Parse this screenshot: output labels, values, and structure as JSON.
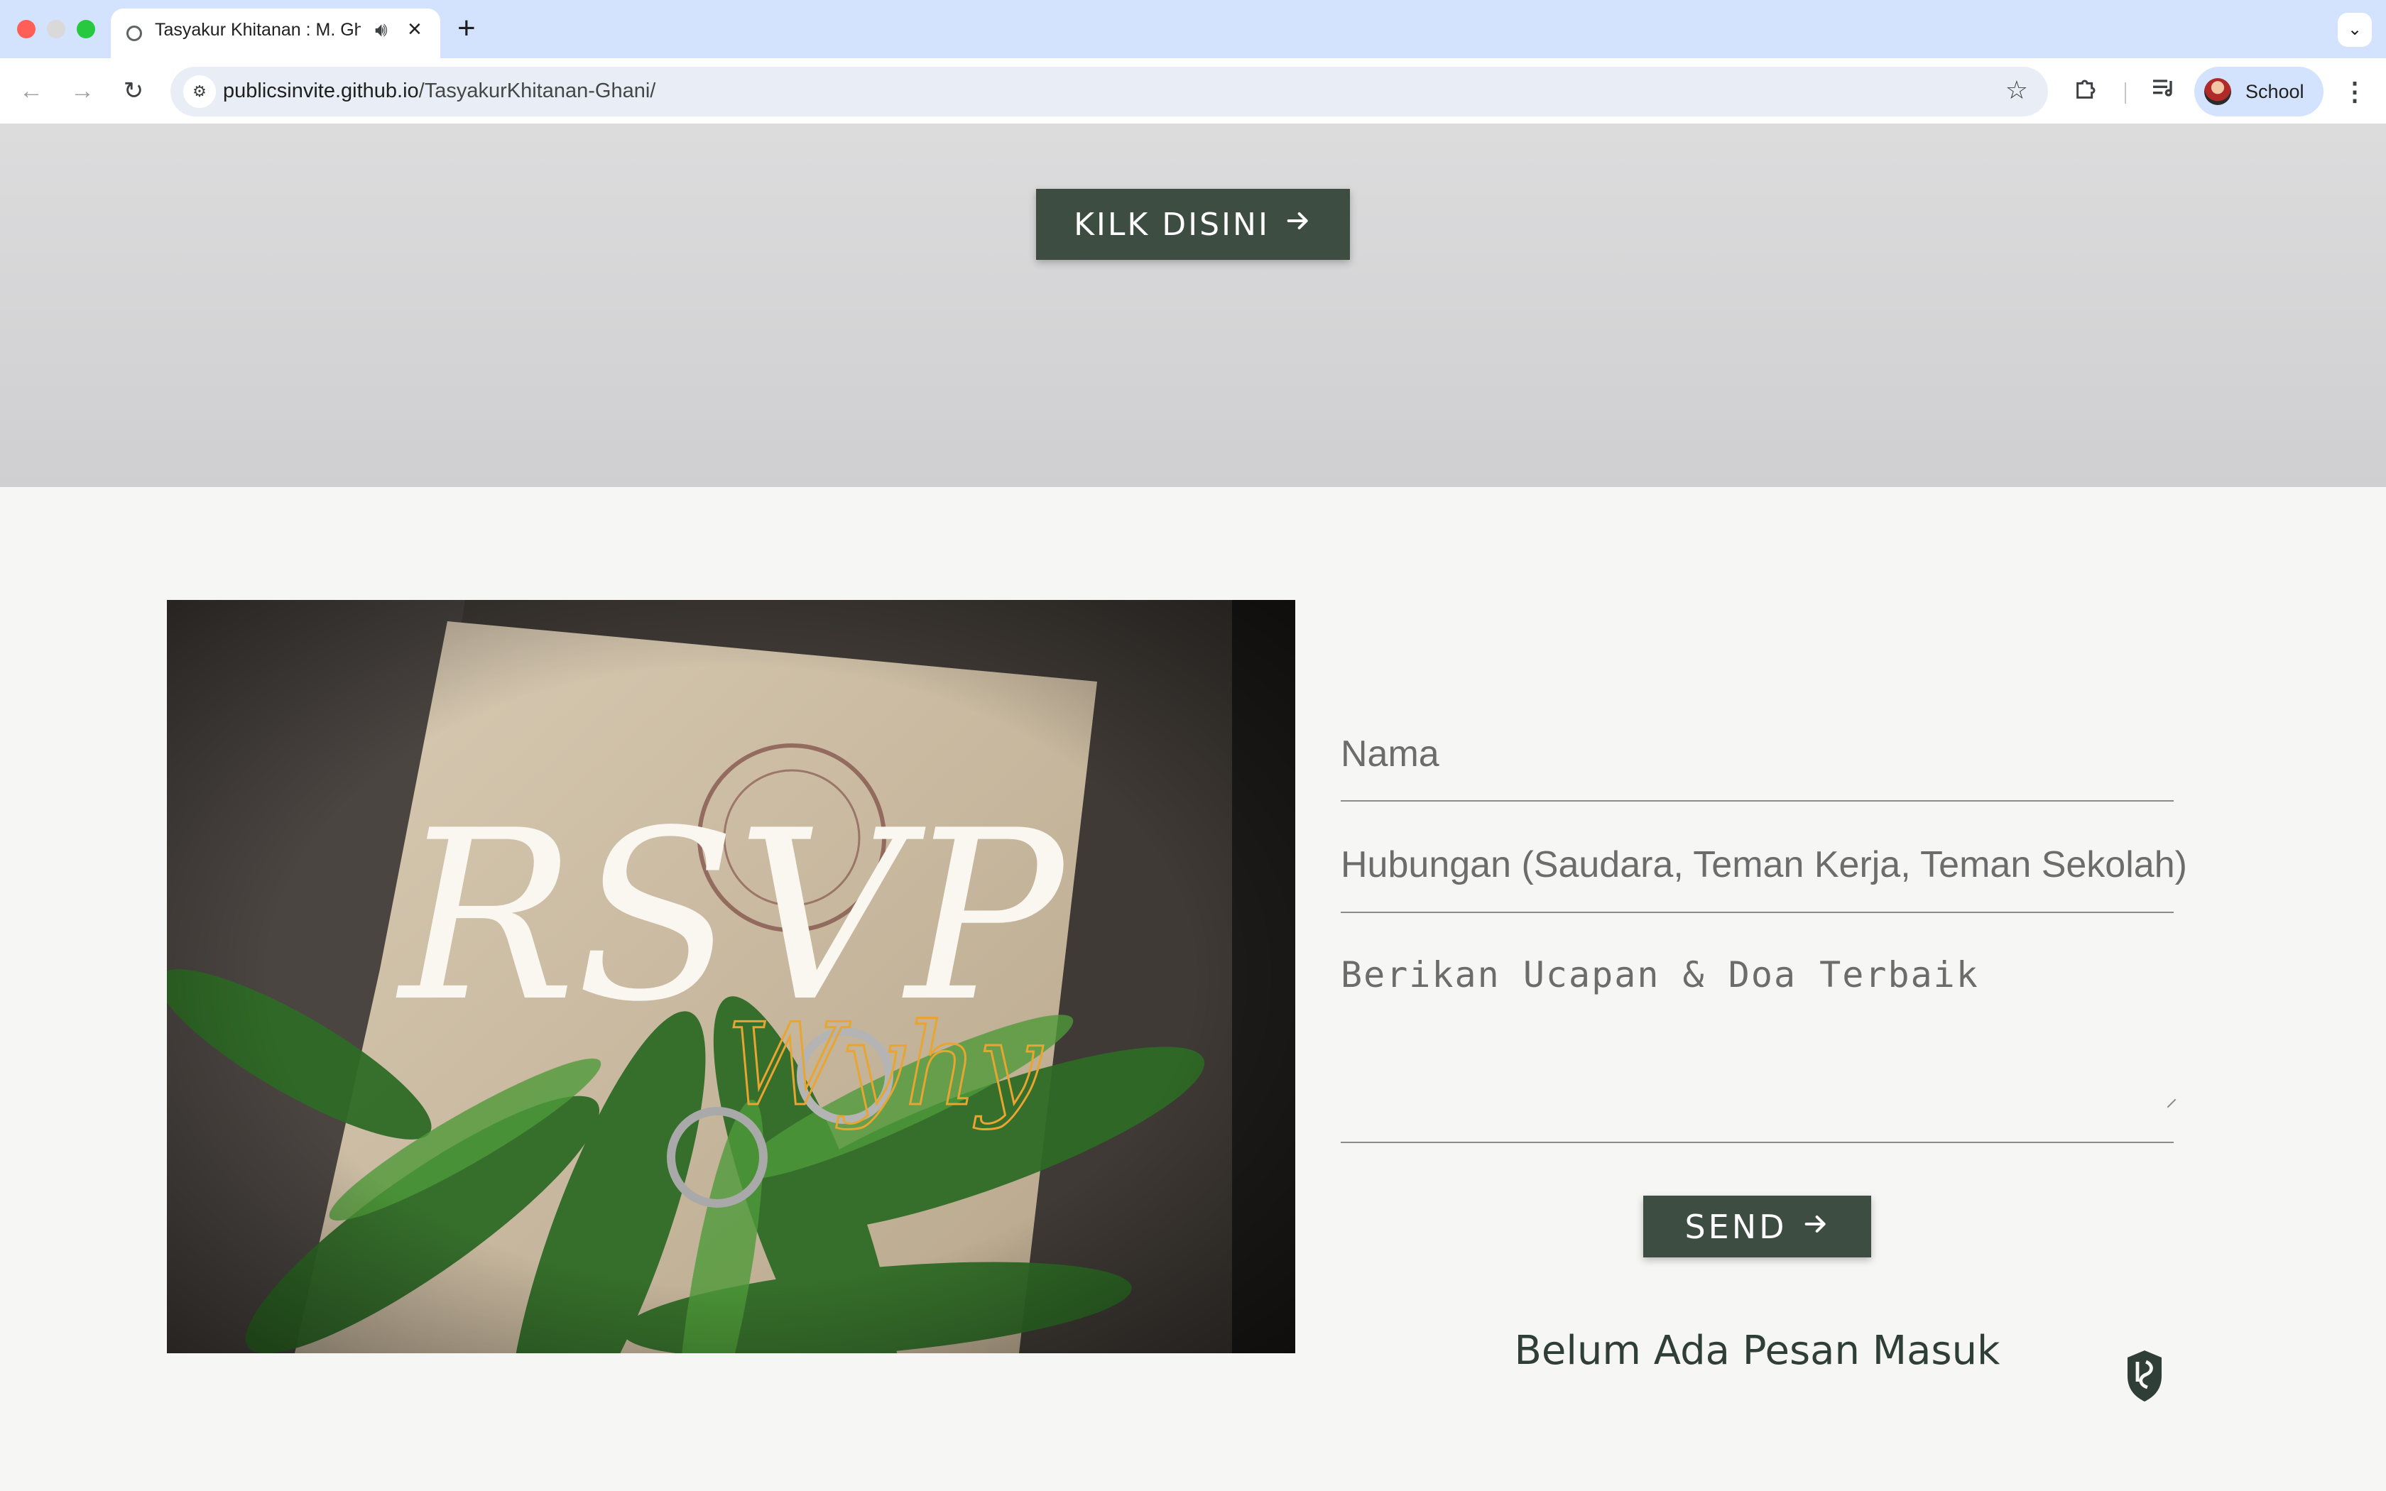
{
  "browser": {
    "tab_title": "Tasyakur Khitanan : M. Gh",
    "url_host": "publicsinvite.github.io",
    "url_path": "/TasyakurKhitanan-Ghani/",
    "profile_name": "School",
    "icons": {
      "favicon": "shield-favicon-icon",
      "audio": "speaker-icon",
      "close": "close-icon",
      "new_tab": "plus-icon",
      "tab_menu": "chevron-down-icon",
      "back": "arrow-left-icon",
      "forward": "arrow-right-icon",
      "reload": "reload-icon",
      "site_info": "tune-icon",
      "bookmark": "star-icon",
      "extensions": "puzzle-icon",
      "media": "media-queue-icon",
      "menu": "kebab-icon"
    }
  },
  "hero": {
    "button_label": "KILK DISINI",
    "button_icon": "arrow-right-icon"
  },
  "rsvp": {
    "image_title": "RSVP",
    "image_signature": "Wyhy",
    "name_placeholder": "Nama",
    "relation_placeholder": "Hubungan (Saudara, Teman Kerja, Teman Sekolah)",
    "message_placeholder": "Berikan Ucapan & Doa Terbaik",
    "send_label": "SEND",
    "send_icon": "arrow-right-icon",
    "empty_messages": "Belum Ada Pesan Masuk"
  },
  "colors": {
    "button_bg": "#3d4d42",
    "page_bg": "#f6f6f5",
    "band_bg": "#d3d3d5",
    "chrome_tab_strip": "#d3e3fd",
    "signature_gold": "#e8a530"
  }
}
